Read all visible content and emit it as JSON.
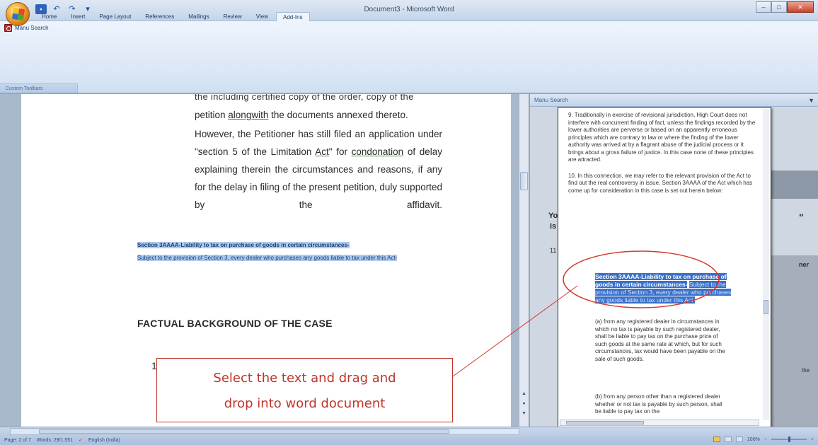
{
  "window": {
    "title": "Document3 - Microsoft Word",
    "min_glyph": "–",
    "max_glyph": "□",
    "close_glyph": "✕"
  },
  "ribbon": {
    "tabs": [
      "Home",
      "Insert",
      "Page Layout",
      "References",
      "Mailings",
      "Review",
      "View",
      "Add-Ins"
    ],
    "active_tab": "Add-Ins",
    "menu_search_label": "Manu Search",
    "group_label": "Custom Toolbars"
  },
  "document": {
    "clipped_line": "the including certified copy of the order, copy of the",
    "line1_prefix": "petition ",
    "line1_link": "alongwith",
    "line1_suffix": " the documents annexed thereto.",
    "para_part1": "However, the Petitioner has still filed an application under \"section 5 of the Limitation ",
    "para_act": "Act",
    "para_part2": "\" for ",
    "para_condonation": "condonation",
    "para_part3": " of delay explaining therein the circumstances and reasons, if any for the delay in filing of the present",
    "para_last": "petition,   duly   supported   by   the   affidavit.",
    "selected_title": "Section 3AAAA-Liability  to tax on purchase of goods  in certain circumstances-",
    "selected_body": "Subject to the provision of Section 3, every dealer who purchases any goods liable to tax under this Act-",
    "heading": "FACTUAL BACKGROUND OF THE CASE",
    "list_number": "1"
  },
  "pane": {
    "title": "Manu Search",
    "chevron": "▼",
    "para9": "9. Traditionally in exercise of revisional jurisdiction, High Court does not interfere with concurrent finding of fact, unless the findings recorded by the lower authorities are perverse or based on an apparently erroneous principles which are contrary to law or where the finding of the lower authority was arrived at by a flagrant abuse of the judicial process or it brings about a gross failure of justice. In this case none of these principles are attracted.",
    "para10": "10. In this connection, we may refer to the relevant provision of the Act to find out the real controversy in issue. Section 3AAAA of the Act which has come up for consideration in this case is set out herein below:",
    "selected_title": "Section 3AAAA-Liability to tax on purchase of goods in certain circumstances-",
    "selected_body": "Subject to the provision of Section 3, every dealer who purchases any goods liable to tax under this Act-",
    "item_a": "(a) from any registered dealer in circumstances in which no tax is payable by such registered dealer, shall be liable to pay tax on the purchase price of such goods at the same rate at which, but for such circumstances, tax would have been payable on the sale of such goods.",
    "item_b": "(b) from any person other than a registered dealer whether or not tax is payable by such person, shall be liable to pay tax on the",
    "background_frag1": "Yo",
    "background_frag2": "is",
    "background_frag3": "11",
    "background_frag4": "ner",
    "background_frag5": "\"",
    "background_frag6": "the"
  },
  "annotation": {
    "line1": "Select the text and drag and",
    "line2": "drop into word document",
    "color": "#c0342b"
  },
  "status": {
    "page": "Page: 2 of 7",
    "words": "Words: 29/1,551",
    "language": "English (India)",
    "zoom": "100%",
    "zoom_out": "−",
    "zoom_in": "+"
  }
}
